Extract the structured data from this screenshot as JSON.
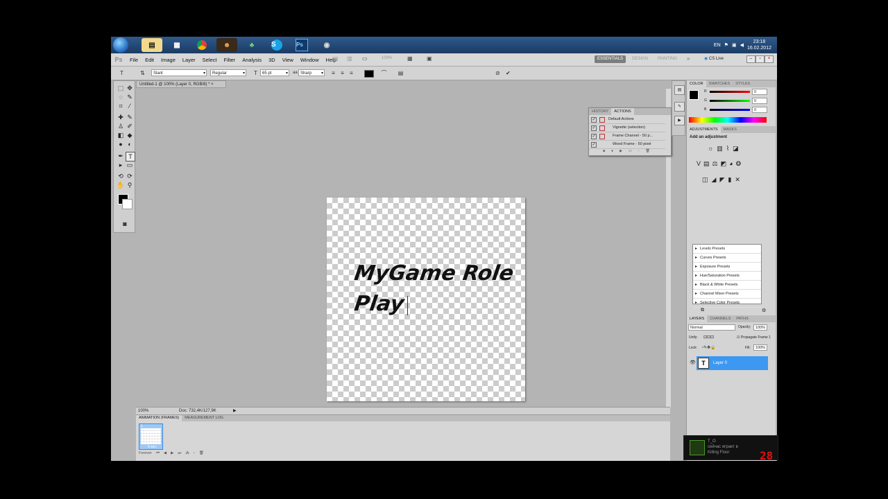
{
  "taskbar": {
    "icons": [
      "explorer-icon",
      "clapper-icon",
      "chrome-icon",
      "game-icon",
      "app-icon",
      "skype-icon",
      "photoshop-icon",
      "media-icon"
    ],
    "language": "EN",
    "time": "23:18",
    "date": "16.02.2012"
  },
  "app": {
    "logo": "Ps",
    "menu": [
      "File",
      "Edit",
      "Image",
      "Layer",
      "Select",
      "Filter",
      "Analysis",
      "3D",
      "View",
      "Window",
      "Help"
    ],
    "zoom_display": "100%",
    "workspaces": [
      "ESSENTIALS",
      "DESIGN",
      "PAINTING"
    ],
    "cs_live": "CS Live"
  },
  "options": {
    "font_family": "Slant",
    "font_style": "Regular",
    "font_size": "65 pt",
    "aa_label": "aa",
    "antialias": "Sharp"
  },
  "document": {
    "tab_title": "Untitled-1 @ 100% (Layer 0, RGB/8) *",
    "text_line1": "MyGame Role",
    "text_line2": "Play",
    "status_zoom": "100%",
    "status_doc": "Doc: 732,4K/127,9K"
  },
  "animation": {
    "tabs": [
      "ANIMATION (FRAMES)",
      "MEASUREMENT LOG"
    ],
    "frame_number": "1",
    "frame_time": "0 sec.",
    "loop": "Forever"
  },
  "history": {
    "tabs": [
      "HISTORY",
      "ACTIONS"
    ],
    "rows": [
      "Default Actions",
      "Vignette (selection)",
      "Frame Channel - 50 p...",
      "Wood Frame - 50 pixel"
    ]
  },
  "color": {
    "tabs": [
      "COLOR",
      "SWATCHES",
      "STYLES"
    ],
    "channels": [
      "R",
      "G",
      "B"
    ],
    "values": [
      "0",
      "0",
      "0"
    ]
  },
  "adjustments": {
    "tabs": [
      "ADJUSTMENTS",
      "MASKS"
    ],
    "heading": "Add an adjustment",
    "presets": [
      "Levels Presets",
      "Curves Presets",
      "Exposure Presets",
      "Hue/Saturation Presets",
      "Black & White Presets",
      "Channel Mixer Presets",
      "Selective Color Presets"
    ]
  },
  "layers": {
    "tabs": [
      "LAYERS",
      "CHANNELS",
      "PATHS"
    ],
    "blend_mode": "Normal",
    "opacity_label": "Opacity:",
    "opacity": "100%",
    "unify_label": "Unify:",
    "propagate": "Propagate Frame 1",
    "lock_label": "Lock:",
    "fill_label": "Fill:",
    "fill": "100%",
    "layer_name": "Layer 0",
    "layer_type_glyph": "T"
  },
  "notification": {
    "user": "T_O",
    "line1": "сейчас играет в",
    "line2": "Killing Floor"
  },
  "counter": "28"
}
